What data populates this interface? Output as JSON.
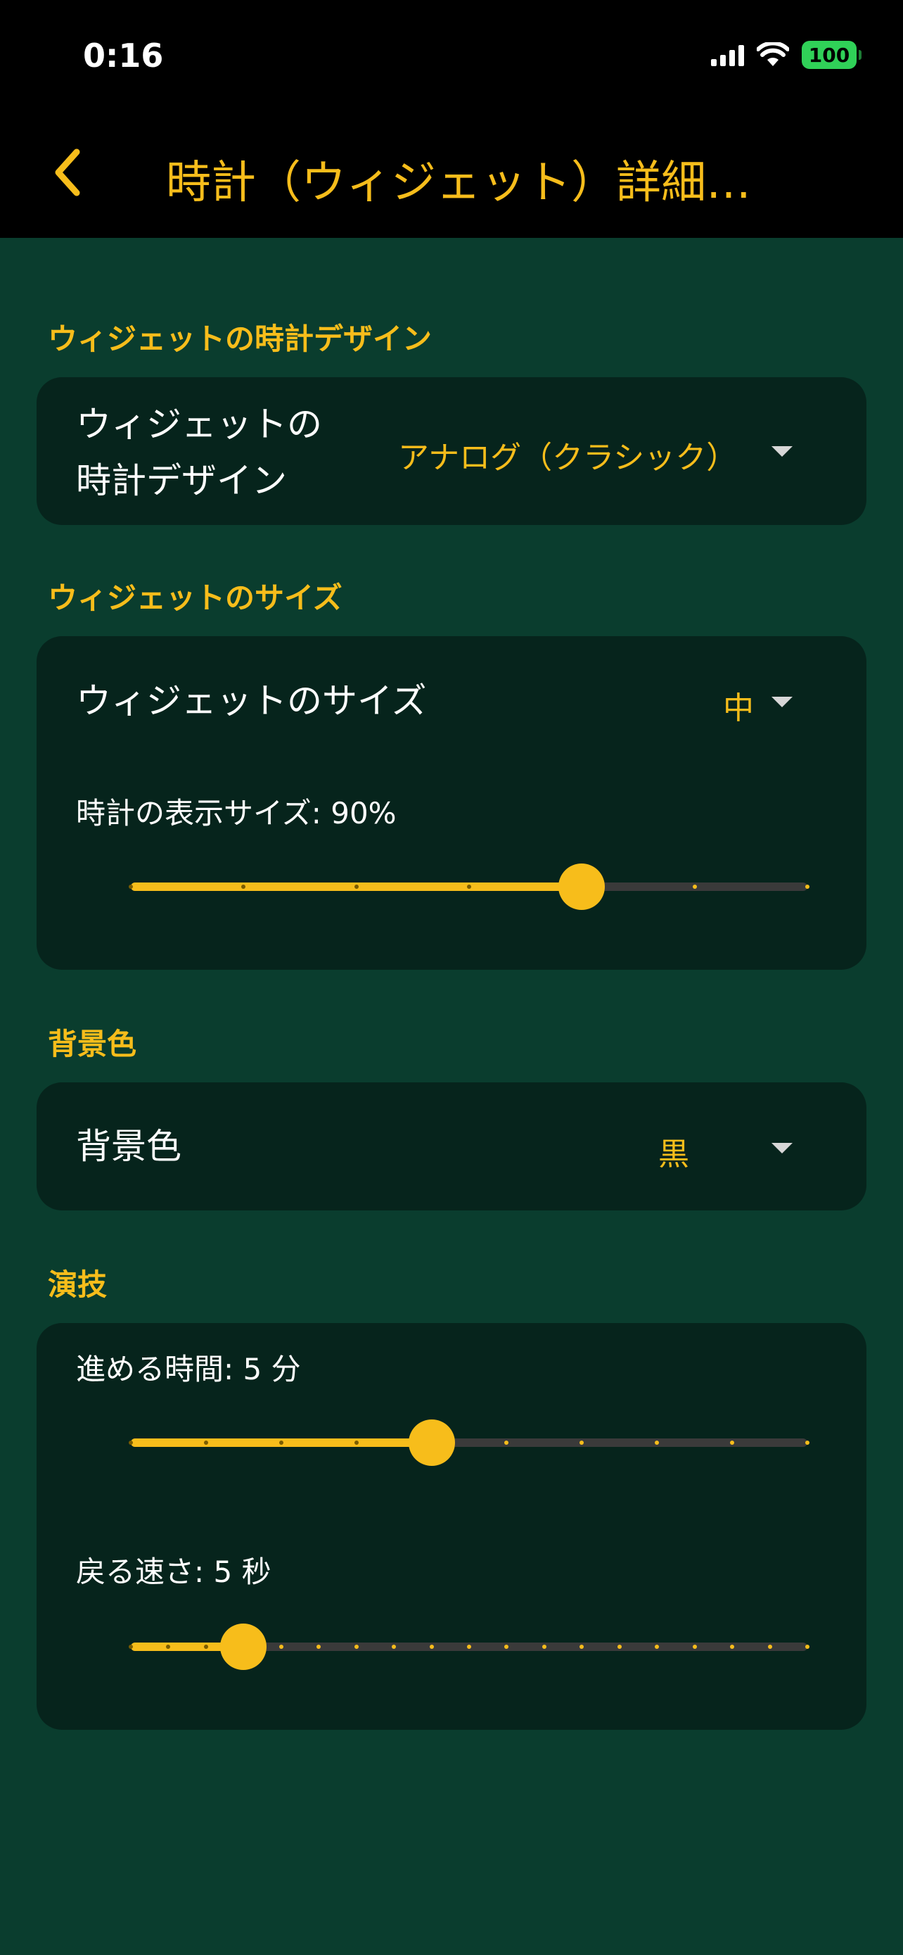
{
  "status_bar": {
    "time": "0:16",
    "battery": "100"
  },
  "nav": {
    "title": "時計（ウィジェット）詳細…",
    "back_icon": "chevron-left-icon"
  },
  "design_section": {
    "title": "ウィジェットの時計デザイン",
    "row_label_line1": "ウィジェットの",
    "row_label_line2": "時計デザイン",
    "value": "アナログ（クラシック）"
  },
  "size_section": {
    "title": "ウィジェットのサイズ",
    "row_label": "ウィジェットのサイズ",
    "value": "中",
    "slider_label": "時計の表示サイズ: 90%",
    "slider": {
      "min": 0,
      "max": 6,
      "value": 4
    }
  },
  "background_section": {
    "title": "背景色",
    "row_label": "背景色",
    "value": "黒"
  },
  "performance_section": {
    "title": "演技",
    "advance_label": "進める時間: 5 分",
    "advance_slider": {
      "min": 0,
      "max": 9,
      "value": 4
    },
    "return_label": "戻る速さ: 5 秒",
    "return_slider": {
      "min": 0,
      "max": 18,
      "value": 3
    }
  },
  "colors": {
    "accent": "#f7bd1b",
    "background": "#0a3d2e",
    "card": "#06241c",
    "track": "#3a3a3a"
  }
}
